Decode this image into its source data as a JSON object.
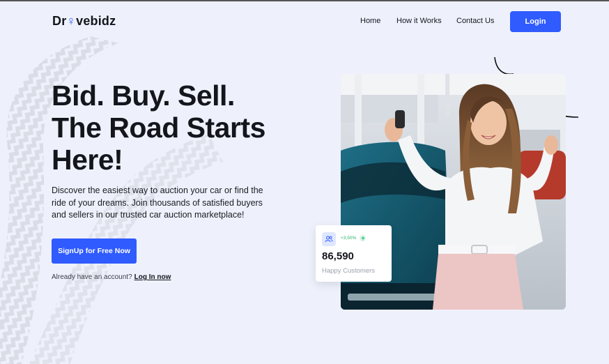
{
  "brand": {
    "pre": "Dr",
    "key": "♀",
    "post": "vebidz"
  },
  "nav": {
    "home": "Home",
    "how_it_works": "How it Works",
    "contact": "Contact Us",
    "login": "Login"
  },
  "hero": {
    "headline_line1": "Bid. Buy. Sell.",
    "headline_line2": "The Road Starts",
    "headline_line3": "Here!",
    "description": "Discover the easiest way to auction your car or find the ride of your dreams. Join thousands of satisfied buyers and sellers in our trusted car auction marketplace!",
    "cta": "SignUp for Free Now",
    "already_text": "Already have an account?",
    "login_link": "Log In now"
  },
  "stat": {
    "change": "+3,50%",
    "value": "86,590",
    "label": "Happy Customers"
  },
  "colors": {
    "accent": "#2f5bff",
    "background": "#eef1fb",
    "positive": "#27b36b"
  },
  "icons": {
    "stat": "users-icon",
    "trend": "arrow-up-icon",
    "brand_key": "car-key-icon"
  }
}
